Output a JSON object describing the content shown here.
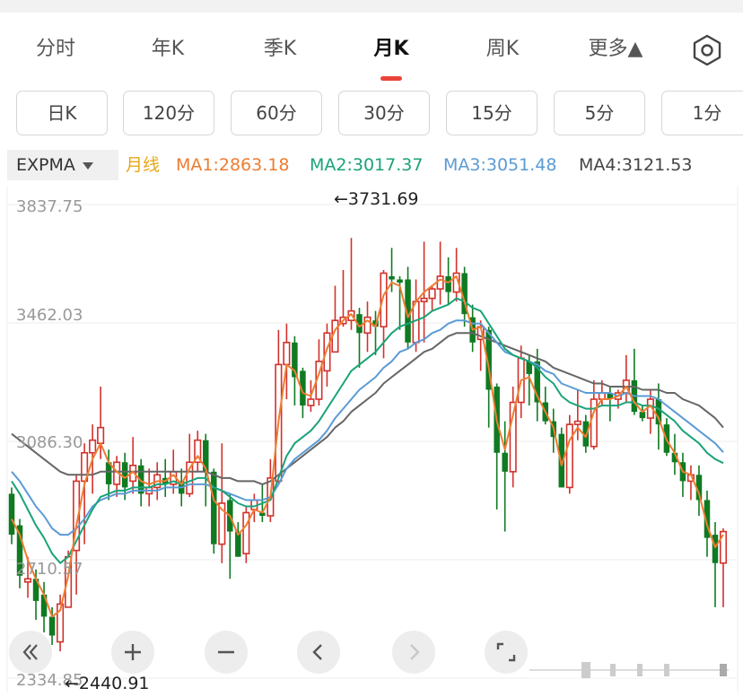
{
  "tabs": [
    "分时",
    "年K",
    "季K",
    "月K",
    "周K",
    "更多▲"
  ],
  "active_tab": "月K",
  "periods": [
    "日K",
    "120分",
    "60分",
    "30分",
    "15分",
    "5分",
    "1分"
  ],
  "indicator": {
    "selector": "EXPMA",
    "line_type": "月线",
    "ma1": "MA1:2863.18",
    "ma2": "MA2:3017.37",
    "ma3": "MA3:3051.48",
    "ma4": "MA4:3121.53"
  },
  "colors": {
    "up": "#d2312b",
    "down": "#0f7a22",
    "ma1": "#ed7d31",
    "ma2": "#1aa37a",
    "ma3": "#5b9bd5",
    "ma4": "#666666",
    "line_label": "#e6a817"
  },
  "chart_data": {
    "type": "candlestick",
    "y_ticks": [
      "3837.75",
      "3462.03",
      "3086.30",
      "2710.57",
      "2334.85"
    ],
    "ylim": [
      2334.85,
      3837.75
    ],
    "annotations": {
      "high": "←3731.69",
      "low": "←2440.91"
    },
    "candles": [
      [
        2920,
        2790,
        2940,
        2760
      ],
      [
        2820,
        2660,
        2840,
        2620
      ],
      [
        2640,
        2650,
        2720,
        2590
      ],
      [
        2650,
        2580,
        2680,
        2520
      ],
      [
        2600,
        2530,
        2640,
        2480
      ],
      [
        2530,
        2470,
        2560,
        2440
      ],
      [
        2450,
        2570,
        2600,
        2420
      ],
      [
        2560,
        2720,
        2740,
        2560
      ],
      [
        2740,
        2960,
        2980,
        2600
      ],
      [
        2960,
        3050,
        3080,
        2760
      ],
      [
        3050,
        3090,
        3140,
        2920
      ],
      [
        3080,
        3130,
        3260,
        3030
      ],
      [
        3020,
        2950,
        3060,
        2900
      ],
      [
        2950,
        3020,
        3040,
        2910
      ],
      [
        3020,
        2940,
        3050,
        2900
      ],
      [
        2960,
        3010,
        3100,
        2920
      ],
      [
        3010,
        2920,
        3030,
        2880
      ],
      [
        2920,
        2940,
        3000,
        2880
      ],
      [
        2940,
        2980,
        3020,
        2900
      ],
      [
        2970,
        2950,
        3030,
        2910
      ],
      [
        2950,
        2990,
        3060,
        2920
      ],
      [
        2960,
        2920,
        3000,
        2880
      ],
      [
        2920,
        3020,
        3110,
        2910
      ],
      [
        3020,
        3090,
        3120,
        2990
      ],
      [
        3090,
        2990,
        3110,
        2880
      ],
      [
        2990,
        2760,
        3000,
        2730
      ],
      [
        2760,
        2890,
        3080,
        2700
      ],
      [
        2900,
        2800,
        2920,
        2650
      ],
      [
        2800,
        2720,
        2830,
        2720
      ],
      [
        2730,
        2860,
        2880,
        2700
      ],
      [
        2870,
        2900,
        2920,
        2830
      ],
      [
        2860,
        2850,
        2950,
        2830
      ],
      [
        2850,
        2970,
        3030,
        2830
      ],
      [
        2960,
        3330,
        3440,
        2950
      ],
      [
        3330,
        3400,
        3460,
        3220
      ],
      [
        3400,
        3290,
        3420,
        3200
      ],
      [
        3310,
        3200,
        3320,
        3160
      ],
      [
        3200,
        3220,
        3280,
        3180
      ],
      [
        3220,
        3340,
        3410,
        3200
      ],
      [
        3310,
        3430,
        3460,
        3260
      ],
      [
        3370,
        3470,
        3580,
        3450
      ],
      [
        3460,
        3480,
        3630,
        3450
      ],
      [
        3470,
        3500,
        3731.69,
        3440
      ],
      [
        3490,
        3430,
        3510,
        3320
      ],
      [
        3430,
        3480,
        3530,
        3370
      ],
      [
        3470,
        3450,
        3500,
        3360
      ],
      [
        3450,
        3620,
        3630,
        3350
      ],
      [
        3610,
        3600,
        3700,
        3560
      ],
      [
        3600,
        3590,
        3610,
        3440
      ],
      [
        3600,
        3400,
        3640,
        3380
      ],
      [
        3400,
        3530,
        3600,
        3370
      ],
      [
        3530,
        3540,
        3720,
        3400
      ],
      [
        3540,
        3570,
        3580,
        3500
      ],
      [
        3570,
        3610,
        3720,
        3520
      ],
      [
        3610,
        3560,
        3670,
        3520
      ],
      [
        3560,
        3620,
        3700,
        3530
      ],
      [
        3620,
        3490,
        3640,
        3450
      ],
      [
        3480,
        3400,
        3520,
        3370
      ],
      [
        3410,
        3450,
        3470,
        3310
      ],
      [
        3440,
        3250,
        3450,
        3130
      ],
      [
        3260,
        3050,
        3270,
        2870
      ],
      [
        3050,
        2990,
        3150,
        2800
      ],
      [
        2990,
        3210,
        3260,
        2940
      ],
      [
        3210,
        3350,
        3390,
        3160
      ],
      [
        3340,
        3300,
        3360,
        3200
      ],
      [
        3340,
        3210,
        3380,
        3150
      ],
      [
        3210,
        3150,
        3260,
        3140
      ],
      [
        3150,
        3100,
        3190,
        3050
      ],
      [
        3110,
        2940,
        3130,
        2940
      ],
      [
        2940,
        3140,
        3170,
        2920
      ],
      [
        3140,
        3150,
        3250,
        3090
      ],
      [
        3150,
        3070,
        3170,
        3050
      ],
      [
        3070,
        3220,
        3280,
        3060
      ],
      [
        3220,
        3240,
        3280,
        3200
      ],
      [
        3240,
        3220,
        3260,
        3150
      ],
      [
        3220,
        3240,
        3250,
        3190
      ],
      [
        3240,
        3280,
        3360,
        3210
      ],
      [
        3280,
        3180,
        3380,
        3170
      ],
      [
        3180,
        3160,
        3200,
        3150
      ],
      [
        3160,
        3220,
        3250,
        3110
      ],
      [
        3220,
        3140,
        3270,
        3060
      ],
      [
        3140,
        3050,
        3160,
        3040
      ],
      [
        3050,
        3020,
        3110,
        2980
      ],
      [
        3020,
        2960,
        3050,
        2910
      ],
      [
        2960,
        2980,
        3010,
        2900
      ],
      [
        2980,
        2900,
        3010,
        2850
      ],
      [
        2900,
        2780,
        2930,
        2720
      ],
      [
        2790,
        2700,
        2830,
        2560
      ],
      [
        2700,
        2800,
        2810,
        2560
      ]
    ],
    "ma1": [
      2840,
      2790,
      2710,
      2650,
      2600,
      2530,
      2550,
      2660,
      2820,
      2950,
      3030,
      3080,
      3020,
      2990,
      2970,
      2990,
      2960,
      2950,
      2960,
      2960,
      2980,
      2950,
      3000,
      3040,
      3000,
      2900,
      2870,
      2850,
      2790,
      2820,
      2870,
      2860,
      2910,
      3150,
      3330,
      3310,
      3240,
      3230,
      3300,
      3380,
      3440,
      3470,
      3490,
      3450,
      3470,
      3450,
      3550,
      3590,
      3580,
      3480,
      3530,
      3560,
      3580,
      3600,
      3590,
      3610,
      3530,
      3440,
      3450,
      3320,
      3150,
      3060,
      3170,
      3280,
      3290,
      3230,
      3180,
      3130,
      3010,
      3090,
      3130,
      3100,
      3180,
      3220,
      3220,
      3230,
      3260,
      3210,
      3180,
      3200,
      3160,
      3090,
      3050,
      2990,
      2980,
      2920,
      2820,
      2750,
      2790
    ],
    "ma2": [
      2960,
      2920,
      2870,
      2820,
      2780,
      2730,
      2700,
      2720,
      2770,
      2820,
      2870,
      2910,
      2920,
      2930,
      2930,
      2940,
      2940,
      2940,
      2950,
      2950,
      2960,
      2950,
      2960,
      2970,
      2970,
      2940,
      2930,
      2910,
      2890,
      2880,
      2880,
      2890,
      2900,
      2970,
      3040,
      3080,
      3100,
      3120,
      3150,
      3190,
      3230,
      3270,
      3310,
      3330,
      3350,
      3370,
      3400,
      3430,
      3450,
      3460,
      3470,
      3480,
      3500,
      3510,
      3520,
      3540,
      3530,
      3510,
      3500,
      3460,
      3420,
      3380,
      3360,
      3350,
      3340,
      3320,
      3290,
      3270,
      3230,
      3210,
      3200,
      3190,
      3190,
      3200,
      3200,
      3200,
      3210,
      3210,
      3200,
      3200,
      3190,
      3170,
      3150,
      3120,
      3100,
      3080,
      3050,
      3030,
      3017.37
    ],
    "ma3": [
      2990,
      2960,
      2920,
      2880,
      2850,
      2810,
      2790,
      2790,
      2810,
      2840,
      2880,
      2900,
      2910,
      2920,
      2920,
      2930,
      2930,
      2930,
      2930,
      2940,
      2940,
      2940,
      2950,
      2950,
      2950,
      2940,
      2930,
      2920,
      2910,
      2900,
      2900,
      2900,
      2910,
      2950,
      3000,
      3030,
      3050,
      3070,
      3090,
      3120,
      3160,
      3190,
      3220,
      3250,
      3270,
      3290,
      3320,
      3340,
      3370,
      3380,
      3400,
      3410,
      3430,
      3440,
      3460,
      3470,
      3470,
      3460,
      3460,
      3430,
      3400,
      3370,
      3360,
      3350,
      3340,
      3330,
      3310,
      3300,
      3270,
      3260,
      3250,
      3240,
      3240,
      3240,
      3240,
      3230,
      3240,
      3230,
      3230,
      3230,
      3220,
      3200,
      3180,
      3160,
      3140,
      3120,
      3100,
      3080,
      3051.48
    ],
    "ma4": [
      3110,
      3090,
      3070,
      3050,
      3030,
      3010,
      2990,
      2980,
      2980,
      2980,
      2980,
      2990,
      2990,
      2990,
      2990,
      2990,
      2990,
      2990,
      2990,
      2990,
      2990,
      2990,
      2990,
      2990,
      2990,
      2980,
      2970,
      2970,
      2960,
      2960,
      2960,
      2950,
      2960,
      2980,
      3000,
      3020,
      3040,
      3060,
      3080,
      3100,
      3130,
      3150,
      3180,
      3200,
      3220,
      3240,
      3270,
      3290,
      3310,
      3330,
      3350,
      3370,
      3380,
      3400,
      3420,
      3430,
      3430,
      3430,
      3420,
      3410,
      3400,
      3390,
      3380,
      3370,
      3360,
      3350,
      3340,
      3320,
      3310,
      3300,
      3290,
      3280,
      3270,
      3270,
      3260,
      3260,
      3260,
      3260,
      3250,
      3250,
      3250,
      3240,
      3240,
      3220,
      3210,
      3200,
      3180,
      3160,
      3130
    ]
  }
}
